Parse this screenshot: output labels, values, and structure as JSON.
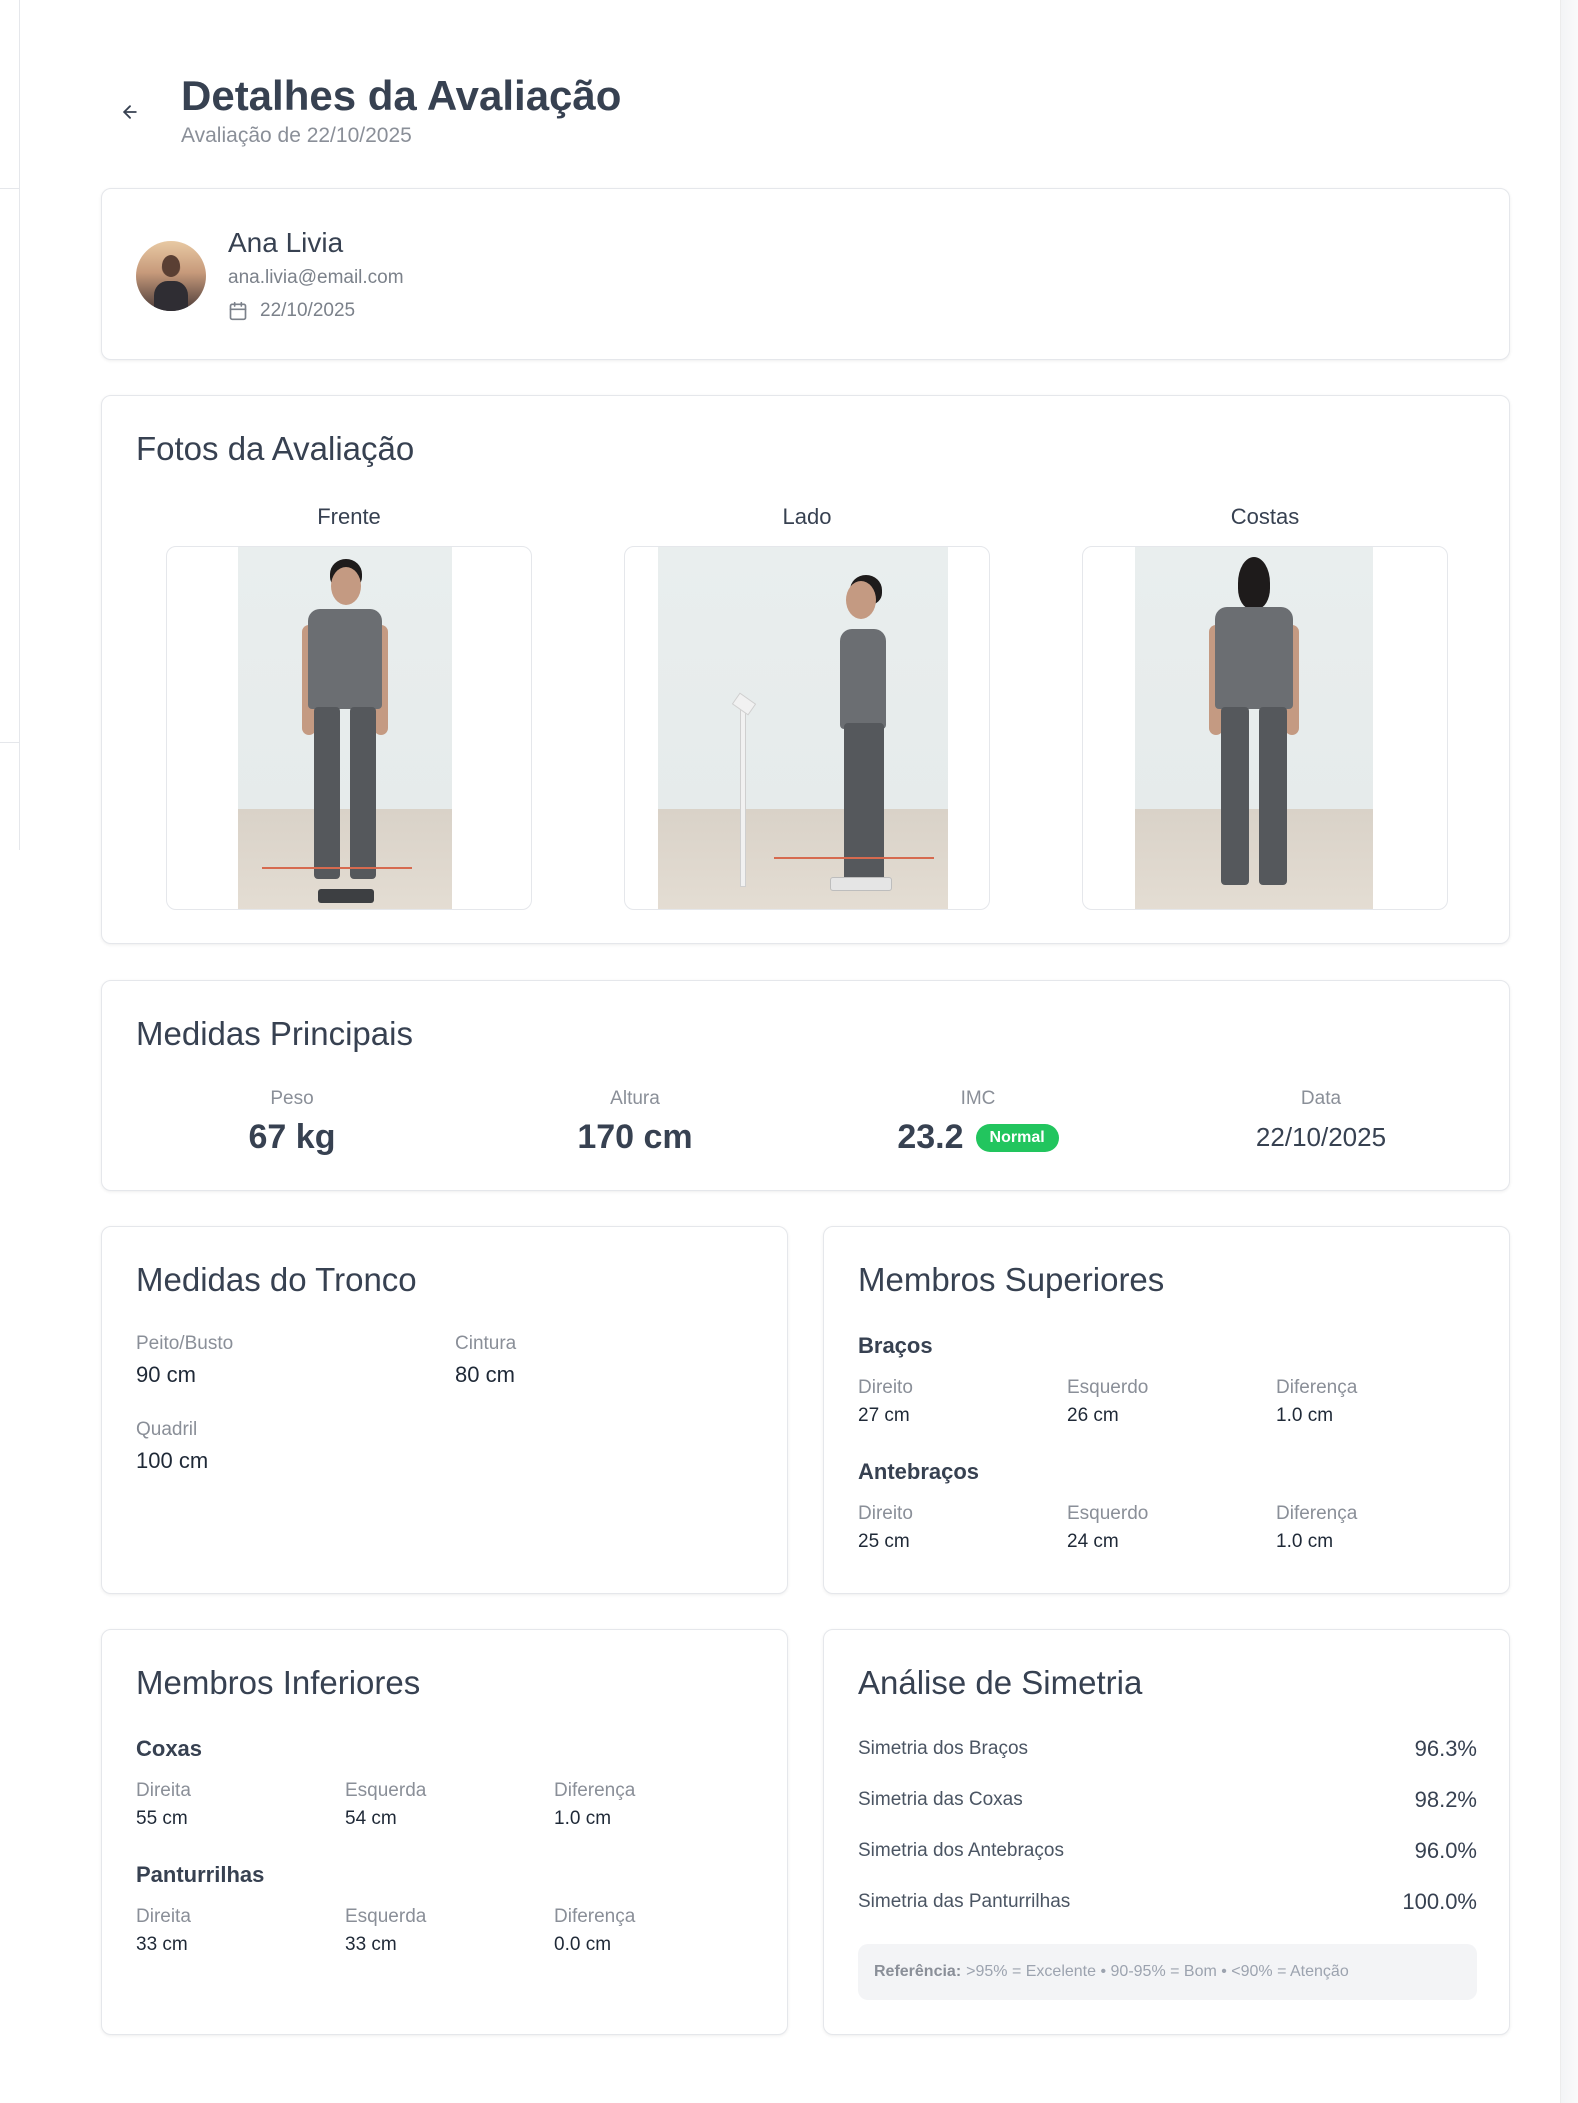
{
  "header": {
    "title": "Detalhes da Avaliação",
    "subtitle": "Avaliação de 22/10/2025"
  },
  "profile": {
    "name": "Ana Livia",
    "email": "ana.livia@email.com",
    "date": "22/10/2025"
  },
  "photos": {
    "title": "Fotos da Avaliação",
    "items": [
      {
        "label": "Frente"
      },
      {
        "label": "Lado"
      },
      {
        "label": "Costas"
      }
    ]
  },
  "main_measures": {
    "title": "Medidas Principais",
    "weight": {
      "label": "Peso",
      "value": "67 kg"
    },
    "height": {
      "label": "Altura",
      "value": "170 cm"
    },
    "bmi": {
      "label": "IMC",
      "value": "23.2",
      "badge": "Normal",
      "badge_color": "#22c55e"
    },
    "date": {
      "label": "Data",
      "value": "22/10/2025"
    }
  },
  "trunk": {
    "title": "Medidas do Tronco",
    "chest": {
      "label": "Peito/Busto",
      "value": "90 cm"
    },
    "waist": {
      "label": "Cintura",
      "value": "80 cm"
    },
    "hip": {
      "label": "Quadril",
      "value": "100 cm"
    }
  },
  "upper_limbs": {
    "title": "Membros Superiores",
    "arms": {
      "title": "Braços",
      "right": {
        "label": "Direito",
        "value": "27 cm"
      },
      "left": {
        "label": "Esquerdo",
        "value": "26 cm"
      },
      "diff": {
        "label": "Diferença",
        "value": "1.0 cm"
      }
    },
    "forearms": {
      "title": "Antebraços",
      "right": {
        "label": "Direito",
        "value": "25 cm"
      },
      "left": {
        "label": "Esquerdo",
        "value": "24 cm"
      },
      "diff": {
        "label": "Diferença",
        "value": "1.0 cm"
      }
    }
  },
  "lower_limbs": {
    "title": "Membros Inferiores",
    "thighs": {
      "title": "Coxas",
      "right": {
        "label": "Direita",
        "value": "55 cm"
      },
      "left": {
        "label": "Esquerda",
        "value": "54 cm"
      },
      "diff": {
        "label": "Diferença",
        "value": "1.0 cm"
      }
    },
    "calves": {
      "title": "Panturrilhas",
      "right": {
        "label": "Direita",
        "value": "33 cm"
      },
      "left": {
        "label": "Esquerda",
        "value": "33 cm"
      },
      "diff": {
        "label": "Diferença",
        "value": "0.0 cm"
      }
    }
  },
  "symmetry": {
    "title": "Análise de Simetria",
    "rows": [
      {
        "name": "Simetria dos Braços",
        "value": "96.3%"
      },
      {
        "name": "Simetria das Coxas",
        "value": "98.2%"
      },
      {
        "name": "Simetria dos Antebraços",
        "value": "96.0%"
      },
      {
        "name": "Simetria das Panturrilhas",
        "value": "100.0%"
      }
    ],
    "reference_label": "Referência:",
    "reference_text": ">95% = Excelente • 90-95% = Bom • <90% = Atenção"
  },
  "icons": {
    "back": "arrow-left-icon",
    "calendar": "calendar-icon"
  }
}
